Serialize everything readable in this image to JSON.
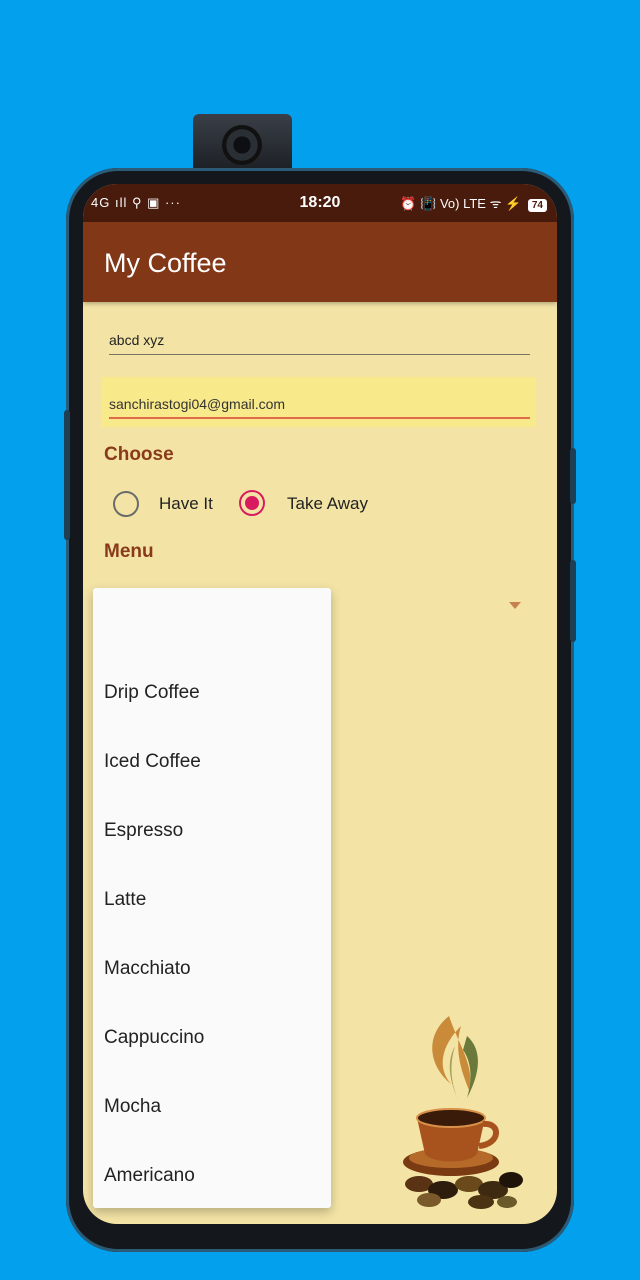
{
  "status_bar": {
    "left_icons": "4G ıll ⚲ ▣ ···",
    "time": "18:20",
    "right_icons": "⏰ 📳 Vo) LTE ᯤ ⚡",
    "battery": "74"
  },
  "app": {
    "title": "My Coffee"
  },
  "form": {
    "name_value": "abcd xyz",
    "email_value": "sanchirastogi04@gmail.com",
    "choose_heading": "Choose",
    "radio_have_it": "Have It",
    "radio_take_away": "Take Away",
    "selected_option": "Take Away",
    "menu_heading": "Menu"
  },
  "dropdown": {
    "items": [
      "",
      "Drip Coffee",
      "Iced Coffee",
      "Espresso",
      "Latte",
      "Macchiato",
      "Cappuccino",
      "Mocha",
      "Americano"
    ]
  },
  "colors": {
    "background": "#03a0ee",
    "status_bar": "#481b0c",
    "app_bar": "#823717",
    "screen_bg": "#f3e4a5",
    "heading": "#8a3a1c",
    "accent": "#d81b60",
    "email_highlight": "#f8e98a"
  },
  "icons": {
    "radio_selected": "radio-checked-icon",
    "radio_unselected": "radio-unchecked-icon",
    "spinner": "dropdown-arrow-icon",
    "decoration": "coffee-cup-icon"
  }
}
